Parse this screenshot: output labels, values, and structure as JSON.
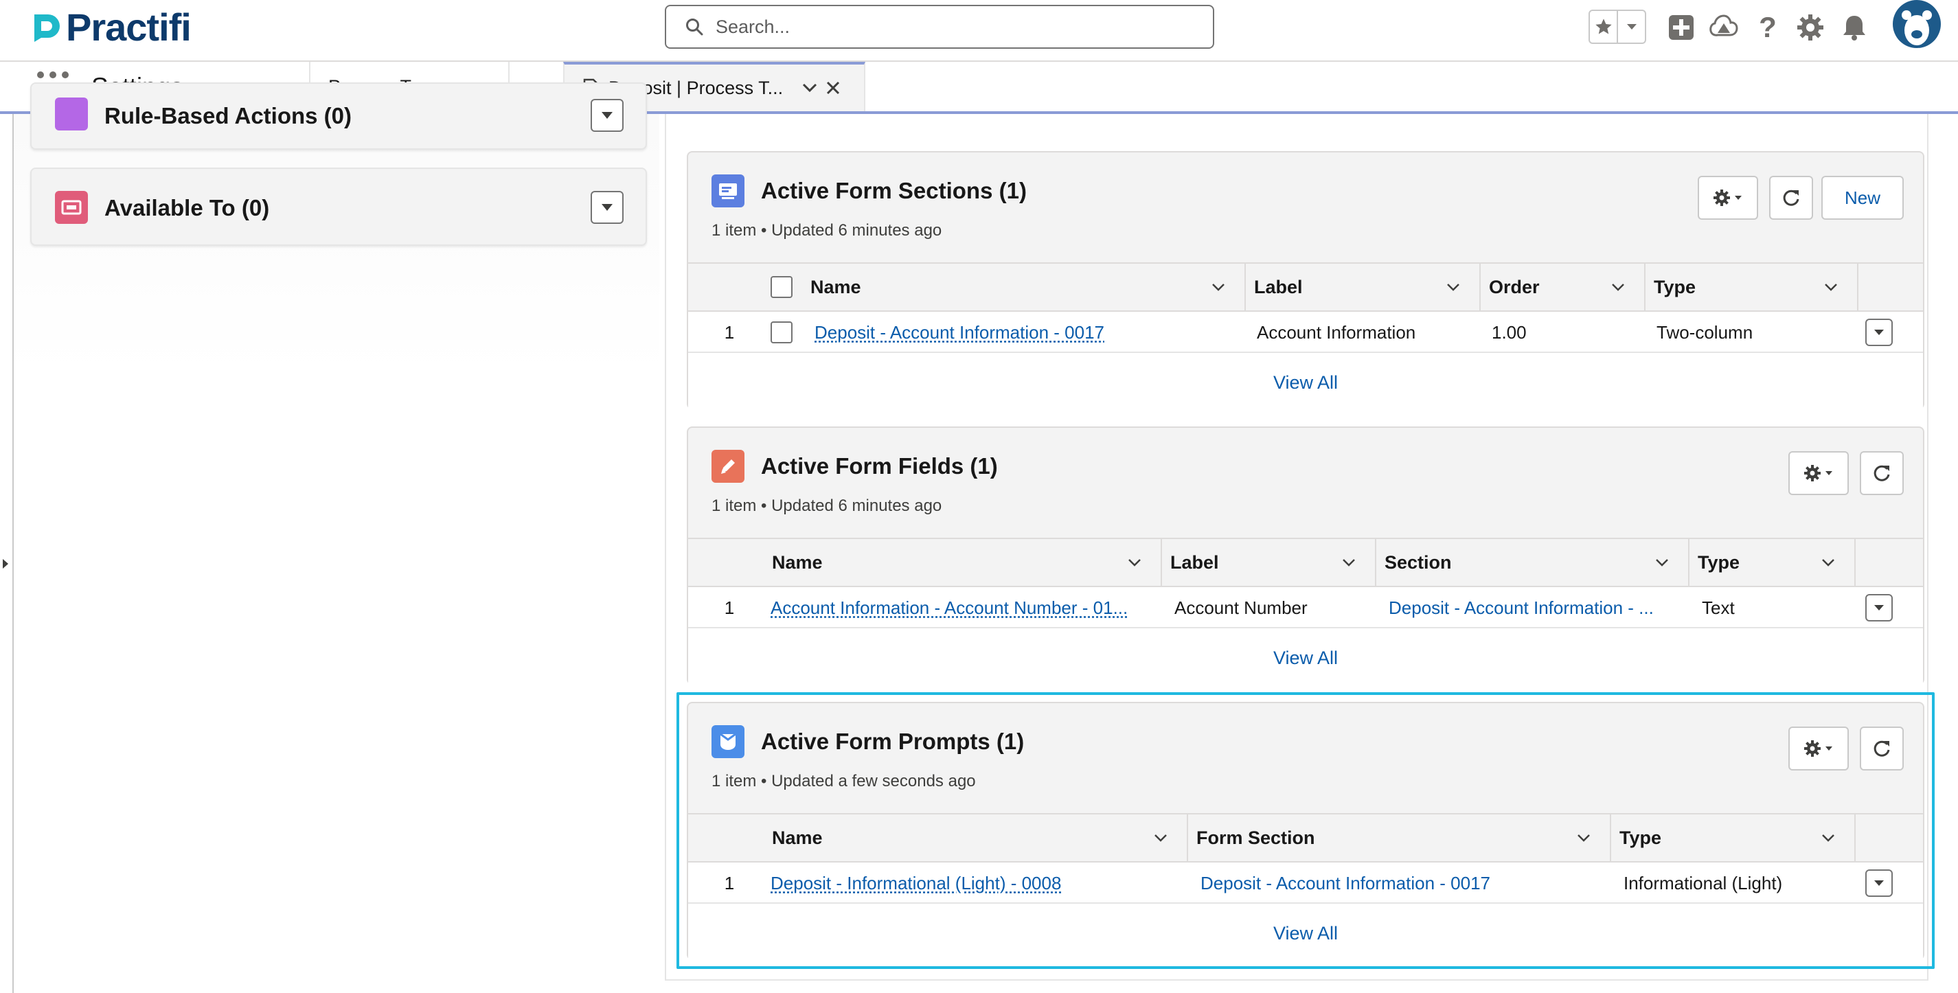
{
  "header": {
    "logo_text": "Practifi",
    "search_placeholder": "Search..."
  },
  "nav": {
    "app_name": "Settings",
    "tabs": [
      {
        "label": "Process Types"
      },
      {
        "label": "Deposit | Process T..."
      }
    ]
  },
  "left_panel": {
    "cards": [
      {
        "title": "Rule-Based Actions (0)"
      },
      {
        "title": "Available To (0)"
      }
    ]
  },
  "sections": {
    "form_sections": {
      "title": "Active Form Sections (1)",
      "meta": "1 item • Updated 6 minutes ago",
      "new_label": "New",
      "columns": [
        "Name",
        "Label",
        "Order",
        "Type"
      ],
      "rows": [
        {
          "num": "1",
          "name": "Deposit - Account Information - 0017",
          "label": "Account Information",
          "order": "1.00",
          "type": "Two-column"
        }
      ],
      "view_all": "View All"
    },
    "form_fields": {
      "title": "Active Form Fields (1)",
      "meta": "1 item • Updated 6 minutes ago",
      "columns": [
        "Name",
        "Label",
        "Section",
        "Type"
      ],
      "rows": [
        {
          "num": "1",
          "name": "Account Information - Account Number - 01...",
          "label": "Account Number",
          "section": "Deposit - Account Information - ...",
          "type": "Text"
        }
      ],
      "view_all": "View All"
    },
    "form_prompts": {
      "title": "Active Form Prompts (1)",
      "meta": "1 item • Updated a few seconds ago",
      "columns": [
        "Name",
        "Form Section",
        "Type"
      ],
      "rows": [
        {
          "num": "1",
          "name": "Deposit - Informational (Light) - 0008",
          "form_section": "Deposit - Account Information - 0017",
          "type": "Informational (Light)"
        }
      ],
      "view_all": "View All"
    }
  },
  "colors": {
    "brand": "#0d3a6b",
    "logo_accent": "#1fb9c9",
    "link": "#0b5cab",
    "highlight": "#1fb9e0",
    "section_icon": "#5c7fe0",
    "field_icon": "#e8735a",
    "prompt_icon": "#4b8de8",
    "rule_icon": "#b467e6",
    "available_icon": "#e05c7a"
  }
}
